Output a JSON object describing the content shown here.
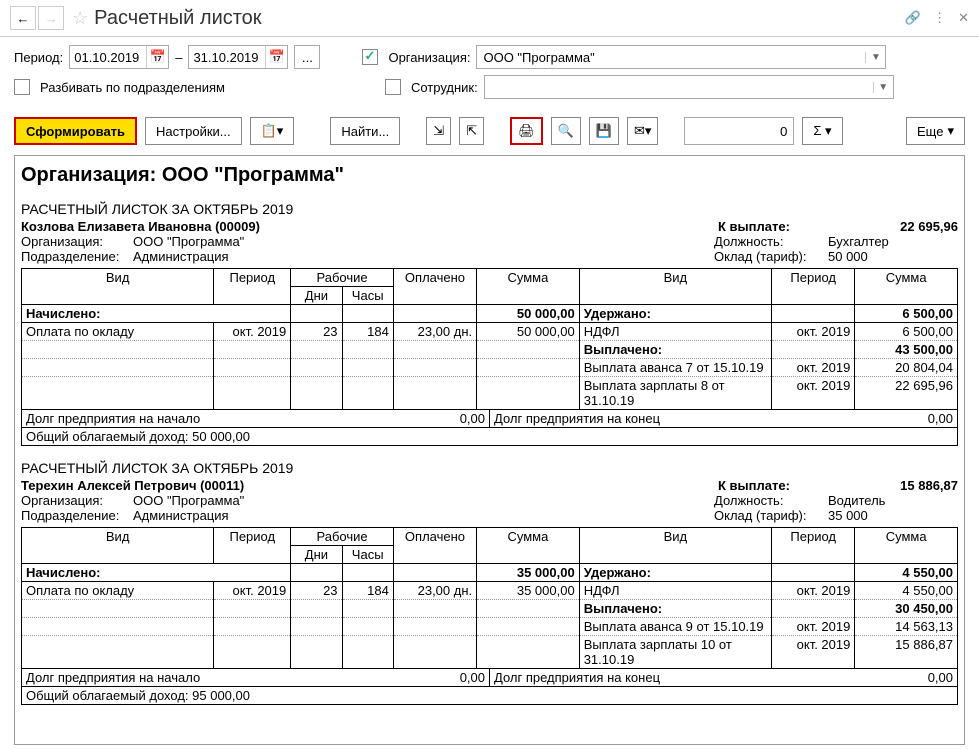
{
  "title": "Расчетный листок",
  "period_label": "Период:",
  "date_from": "01.10.2019",
  "date_to": "31.10.2019",
  "dash": "–",
  "org_label": "Организация:",
  "org_value": "ООО \"Программа\"",
  "split_label": "Разбивать по подразделениям",
  "employee_label": "Сотрудник:",
  "employee_value": "",
  "toolbar": {
    "form": "Сформировать",
    "settings": "Настройки...",
    "find": "Найти...",
    "more": "Еще",
    "num": "0"
  },
  "report": {
    "org_header": "Организация: ООО \"Программа\"",
    "slips": [
      {
        "title": "РАСЧЕТНЫЙ ЛИСТОК ЗА ОКТЯБРЬ 2019",
        "name": "Козлова Елизавета Ивановна (00009)",
        "pay_label": "К выплате:",
        "pay_amount": "22 695,96",
        "org_l": "Организация:",
        "org_v": "ООО \"Программа\"",
        "dep_l": "Подразделение:",
        "dep_v": "Администрация",
        "pos_l": "Должность:",
        "pos_v": "Бухгалтер",
        "rate_l": "Оклад (тариф):",
        "rate_v": "50 000",
        "headers": {
          "vid": "Вид",
          "period": "Период",
          "work": "Рабочие",
          "days": "Дни",
          "hours": "Часы",
          "paid": "Оплачено",
          "sum": "Сумма"
        },
        "left_sections": [
          {
            "label": "Начислено:",
            "total": "50 000,00",
            "rows": [
              {
                "name": "Оплата по окладу",
                "period": "окт. 2019",
                "days": "23",
                "hours": "184",
                "paid": "23,00 дн.",
                "sum": "50 000,00"
              }
            ]
          }
        ],
        "right_sections": [
          {
            "label": "Удержано:",
            "total": "6 500,00",
            "rows": [
              {
                "name": "НДФЛ",
                "period": "окт. 2019",
                "sum": "6 500,00"
              }
            ]
          },
          {
            "label": "Выплачено:",
            "total": "43 500,00",
            "rows": [
              {
                "name": "Выплата аванса 7 от 15.10.19",
                "period": "окт. 2019",
                "sum": "20 804,04"
              },
              {
                "name": "Выплата зарплаты 8 от 31.10.19",
                "period": "окт. 2019",
                "sum": "22 695,96"
              }
            ]
          }
        ],
        "debt_start_l": "Долг предприятия на начало",
        "debt_start_v": "0,00",
        "debt_end_l": "Долг предприятия на конец",
        "debt_end_v": "0,00",
        "income_l": "Общий облагаемый доход:",
        "income_v": "50 000,00"
      },
      {
        "title": "РАСЧЕТНЫЙ ЛИСТОК ЗА ОКТЯБРЬ 2019",
        "name": "Терехин Алексей Петрович (00011)",
        "pay_label": "К выплате:",
        "pay_amount": "15 886,87",
        "org_l": "Организация:",
        "org_v": "ООО \"Программа\"",
        "dep_l": "Подразделение:",
        "dep_v": "Администрация",
        "pos_l": "Должность:",
        "pos_v": "Водитель",
        "rate_l": "Оклад (тариф):",
        "rate_v": "35 000",
        "headers": {
          "vid": "Вид",
          "period": "Период",
          "work": "Рабочие",
          "days": "Дни",
          "hours": "Часы",
          "paid": "Оплачено",
          "sum": "Сумма"
        },
        "left_sections": [
          {
            "label": "Начислено:",
            "total": "35 000,00",
            "rows": [
              {
                "name": "Оплата по окладу",
                "period": "окт. 2019",
                "days": "23",
                "hours": "184",
                "paid": "23,00 дн.",
                "sum": "35 000,00"
              }
            ]
          }
        ],
        "right_sections": [
          {
            "label": "Удержано:",
            "total": "4 550,00",
            "rows": [
              {
                "name": "НДФЛ",
                "period": "окт. 2019",
                "sum": "4 550,00"
              }
            ]
          },
          {
            "label": "Выплачено:",
            "total": "30 450,00",
            "rows": [
              {
                "name": "Выплата аванса 9 от 15.10.19",
                "period": "окт. 2019",
                "sum": "14 563,13"
              },
              {
                "name": "Выплата зарплаты 10 от 31.10.19",
                "period": "окт. 2019",
                "sum": "15 886,87"
              }
            ]
          }
        ],
        "debt_start_l": "Долг предприятия на начало",
        "debt_start_v": "0,00",
        "debt_end_l": "Долг предприятия на конец",
        "debt_end_v": "0,00",
        "income_l": "Общий облагаемый доход:",
        "income_v": "95 000,00"
      }
    ]
  }
}
